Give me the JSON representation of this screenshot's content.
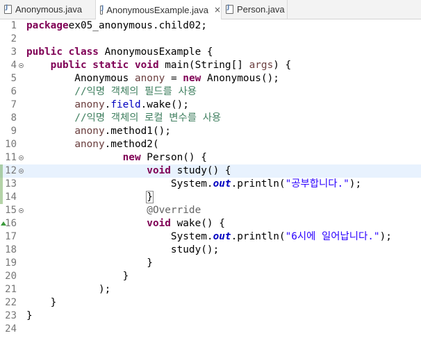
{
  "tabs": [
    {
      "label": "Anonymous.java"
    },
    {
      "label": "AnonymousExample.java",
      "close": "×"
    },
    {
      "label": "Person.java"
    }
  ],
  "lines": [
    {
      "n": "1",
      "tokens": [
        [
          "kw",
          "package"
        ],
        [
          "",
          "ex05_anonymous.child02;"
        ]
      ]
    },
    {
      "n": "2",
      "tokens": []
    },
    {
      "n": "3",
      "tokens": [
        [
          "kw",
          "public class"
        ],
        [
          "",
          " AnonymousExample {"
        ]
      ]
    },
    {
      "n": "4",
      "tokens": [
        [
          "",
          "    "
        ],
        [
          "kw",
          "public static void"
        ],
        [
          "",
          " main(String[] "
        ],
        [
          "var",
          "args"
        ],
        [
          "",
          ") {"
        ]
      ]
    },
    {
      "n": "5",
      "tokens": [
        [
          "",
          "        Anonymous "
        ],
        [
          "var",
          "anony"
        ],
        [
          "",
          " = "
        ],
        [
          "kw",
          "new"
        ],
        [
          "",
          " Anonymous();"
        ]
      ]
    },
    {
      "n": "6",
      "tokens": [
        [
          "",
          "        "
        ],
        [
          "cm",
          "//익명 객체의 필드를 사용"
        ]
      ]
    },
    {
      "n": "7",
      "tokens": [
        [
          "",
          "        "
        ],
        [
          "var",
          "anony"
        ],
        [
          "",
          "."
        ],
        [
          "fld",
          "field"
        ],
        [
          "",
          ".wake();"
        ]
      ]
    },
    {
      "n": "8",
      "tokens": [
        [
          "",
          "        "
        ],
        [
          "cm",
          "//익명 객체의 로컬 변수를 사용"
        ]
      ]
    },
    {
      "n": "9",
      "tokens": [
        [
          "",
          "        "
        ],
        [
          "var",
          "anony"
        ],
        [
          "",
          ".method1();"
        ]
      ]
    },
    {
      "n": "10",
      "tokens": [
        [
          "",
          "        "
        ],
        [
          "var",
          "anony"
        ],
        [
          "",
          ".method2("
        ]
      ]
    },
    {
      "n": "11",
      "tokens": [
        [
          "",
          "                "
        ],
        [
          "kw",
          "new"
        ],
        [
          "",
          " Person() {"
        ]
      ]
    },
    {
      "n": "12",
      "tokens": [
        [
          "",
          "                    "
        ],
        [
          "kw",
          "void"
        ],
        [
          "",
          " study() {"
        ]
      ]
    },
    {
      "n": "13",
      "tokens": [
        [
          "",
          "                        System."
        ],
        [
          "sfld",
          "out"
        ],
        [
          "",
          ".println("
        ],
        [
          "str",
          "\"공부합니다.\""
        ],
        [
          "",
          ");"
        ]
      ]
    },
    {
      "n": "14",
      "tokens": [
        [
          "",
          "                    "
        ],
        [
          "brk",
          "}"
        ]
      ]
    },
    {
      "n": "15",
      "tokens": [
        [
          "",
          "                    "
        ],
        [
          "ann",
          "@Override"
        ]
      ]
    },
    {
      "n": "16",
      "tokens": [
        [
          "",
          "                    "
        ],
        [
          "kw",
          "void"
        ],
        [
          "",
          " wake() {"
        ]
      ]
    },
    {
      "n": "17",
      "tokens": [
        [
          "",
          "                        System."
        ],
        [
          "sfld",
          "out"
        ],
        [
          "",
          ".println("
        ],
        [
          "str",
          "\"6시에 일어납니다.\""
        ],
        [
          "",
          ");"
        ]
      ]
    },
    {
      "n": "18",
      "tokens": [
        [
          "",
          "                        study();"
        ]
      ]
    },
    {
      "n": "19",
      "tokens": [
        [
          "",
          "                    }"
        ]
      ]
    },
    {
      "n": "20",
      "tokens": [
        [
          "",
          "                }"
        ]
      ]
    },
    {
      "n": "21",
      "tokens": [
        [
          "",
          "            );"
        ]
      ]
    },
    {
      "n": "22",
      "tokens": [
        [
          "",
          "    }"
        ]
      ]
    },
    {
      "n": "23",
      "tokens": [
        [
          "",
          "}"
        ]
      ]
    },
    {
      "n": "24",
      "tokens": []
    }
  ],
  "current_line": "12",
  "fold_lines": [
    "4",
    "11",
    "12",
    "15"
  ],
  "override_line": "16",
  "colors": {
    "keyword": "#7f0055",
    "comment": "#3f7f5f",
    "string": "#2a00ff",
    "field": "#0000c0",
    "current_line": "#e8f2fe"
  }
}
